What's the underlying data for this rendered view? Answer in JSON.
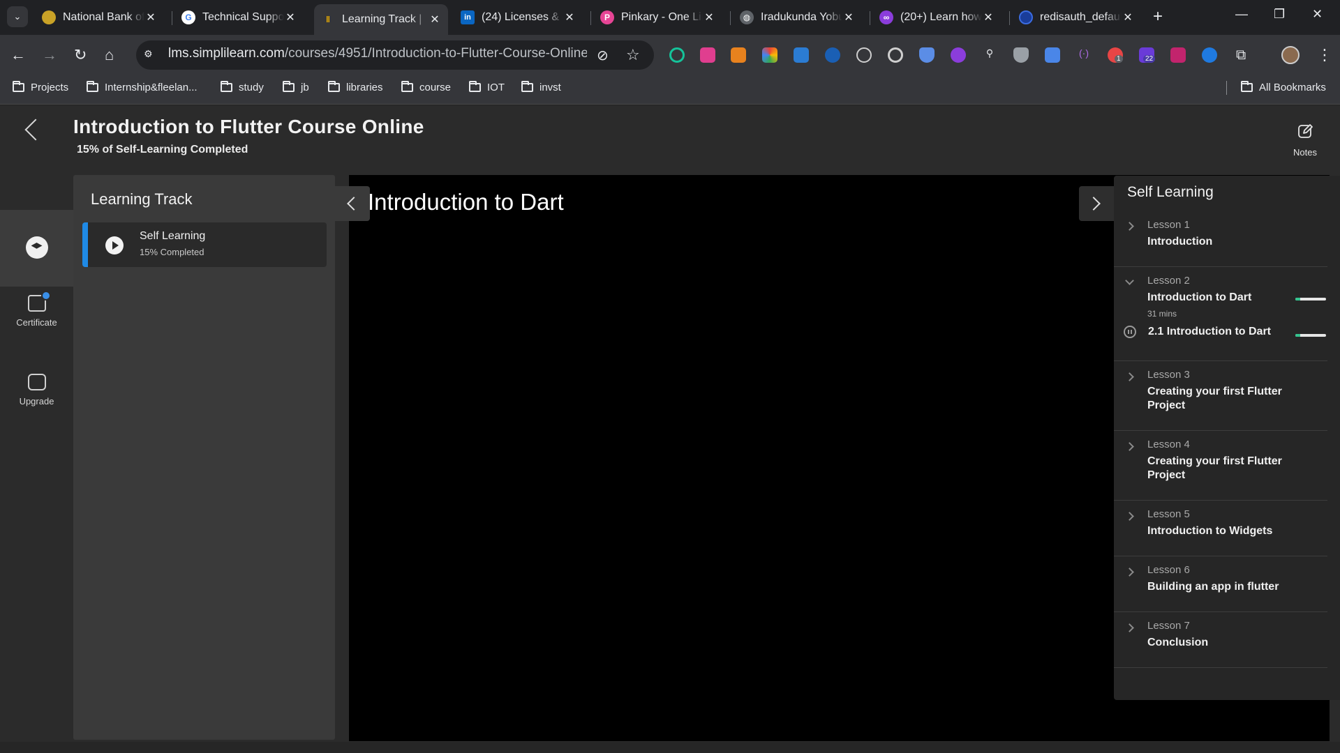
{
  "browser": {
    "tabs": [
      {
        "title": "National Bank of",
        "fav_color": "#c9a227",
        "fav_glyph": "●"
      },
      {
        "title": "Technical Suppor",
        "fav_color": "#ffffff",
        "fav_glyph": "G"
      },
      {
        "title": "Learning Track | ",
        "fav_color": "#f4b400",
        "fav_glyph": "‖",
        "active": true
      },
      {
        "title": "(24) Licenses & c",
        "fav_color": "#0a66c2",
        "fav_glyph": "in"
      },
      {
        "title": "Pinkary - One Lir",
        "fav_color": "#e64595",
        "fav_glyph": "P"
      },
      {
        "title": "Iradukunda Yobu",
        "fav_color": "#9aa0a6",
        "fav_glyph": "◍"
      },
      {
        "title": "(20+) Learn how",
        "fav_color": "#8b3ddb",
        "fav_glyph": "∞"
      },
      {
        "title": "redisauth_defaul",
        "fav_color": "#1a3d9a",
        "fav_glyph": "○"
      }
    ],
    "url_host": "lms.simplilearn.com",
    "url_path": "/courses/4951/Introduction-to-Flutter-Course-Online/sy...",
    "bookmarks": [
      "Projects",
      "Internship&fleelan...",
      "study",
      "jb",
      "libraries",
      "course",
      "IOT",
      "invst"
    ],
    "all_bookmarks": "All Bookmarks",
    "ext_badges": {
      "badge1": "1",
      "badge2": "22"
    }
  },
  "header": {
    "title": "Introduction to Flutter Course Online",
    "progress": "15% of Self-Learning Completed",
    "notes_label": "Notes"
  },
  "rail": {
    "certificate": "Certificate",
    "upgrade": "Upgrade"
  },
  "track": {
    "title": "Learning Track",
    "card_title": "Self Learning",
    "card_sub": "15% Completed"
  },
  "video": {
    "title": "Introduction to Dart"
  },
  "syllabus": {
    "title": "Self Learning",
    "lessons": [
      {
        "num": "Lesson 1",
        "name": "Introduction"
      },
      {
        "num": "Lesson 2",
        "name": "Introduction to Dart",
        "duration": "31 mins",
        "progress": 0.15,
        "sub": "2.1 Introduction to Dart",
        "sub_progress": 0.15
      },
      {
        "num": "Lesson 3",
        "name": "Creating your first Flutter Project"
      },
      {
        "num": "Lesson 4",
        "name": "Creating your first Flutter Project"
      },
      {
        "num": "Lesson 5",
        "name": "Introduction to Widgets"
      },
      {
        "num": "Lesson 6",
        "name": "Building an app in flutter"
      },
      {
        "num": "Lesson 7",
        "name": "Conclusion"
      }
    ]
  }
}
